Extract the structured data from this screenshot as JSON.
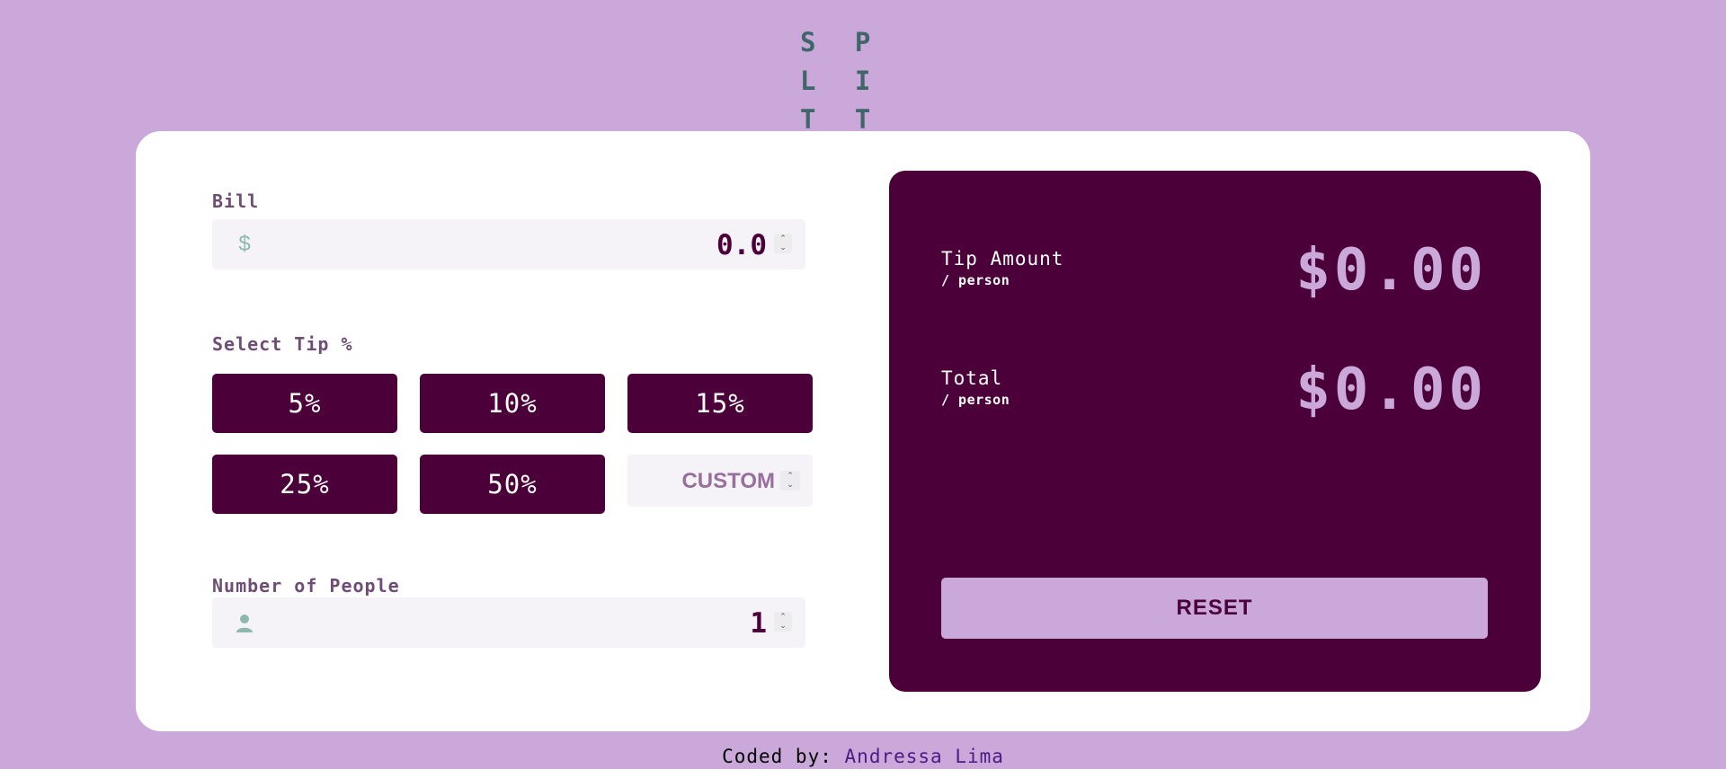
{
  "app": {
    "title": "SPLITTER",
    "logo_text": "S P L I\nT T E R"
  },
  "bill": {
    "label": "Bill",
    "currency_symbol": "$",
    "value": "0.0"
  },
  "tip": {
    "label": "Select Tip %",
    "options": [
      "5%",
      "10%",
      "15%",
      "25%",
      "50%"
    ],
    "custom_label": "CUSTOM"
  },
  "people": {
    "label": "Number of People",
    "value": "1",
    "icon": "person-icon"
  },
  "results": {
    "tip_amount_label": "Tip Amount",
    "tip_amount_sublabel": "/ person",
    "tip_amount_value": "$0.00",
    "total_label": "Total",
    "total_sublabel": "/ person",
    "total_value": "$0.00",
    "reset_label": "RESET"
  },
  "footer": {
    "prefix": "Coded by:",
    "author": "Andressa Lima"
  },
  "colors": {
    "background": "#cba8da",
    "primary": "#4b003a",
    "accent": "#cba8da",
    "logo": "#3f6668",
    "card": "#ffffff",
    "input": "#f5f3f8"
  }
}
